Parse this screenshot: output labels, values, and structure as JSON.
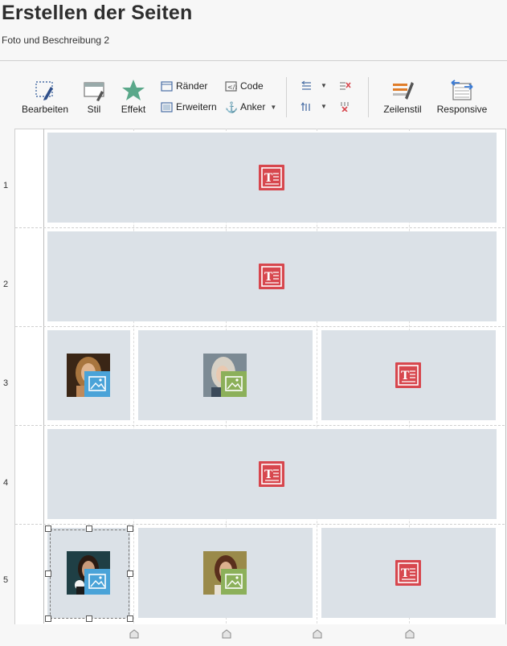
{
  "page": {
    "title": "Erstellen der Seiten",
    "subtitle": "Foto und Beschreibung 2"
  },
  "toolbar": {
    "edit_label": "Bearbeiten",
    "style_label": "Stil",
    "effect_label": "Effekt",
    "borders_label": "Ränder",
    "expand_label": "Erweitern",
    "code_label": "Code",
    "anchor_label": "Anker",
    "rowstyle_label": "Zeilenstil",
    "responsive_label": "Responsive"
  },
  "rows": [
    {
      "number": "1"
    },
    {
      "number": "2"
    },
    {
      "number": "3"
    },
    {
      "number": "4"
    },
    {
      "number": "5"
    }
  ],
  "icons": {
    "text_object": "text-object-icon",
    "image_object": "image-object-icon"
  },
  "colors": {
    "text_icon": "#d7474e",
    "image_badge_blue": "#4aa3d8",
    "image_badge_green": "#8cb05a",
    "cell_bg": "#dbe1e7",
    "effect_star": "#5aa88a"
  }
}
